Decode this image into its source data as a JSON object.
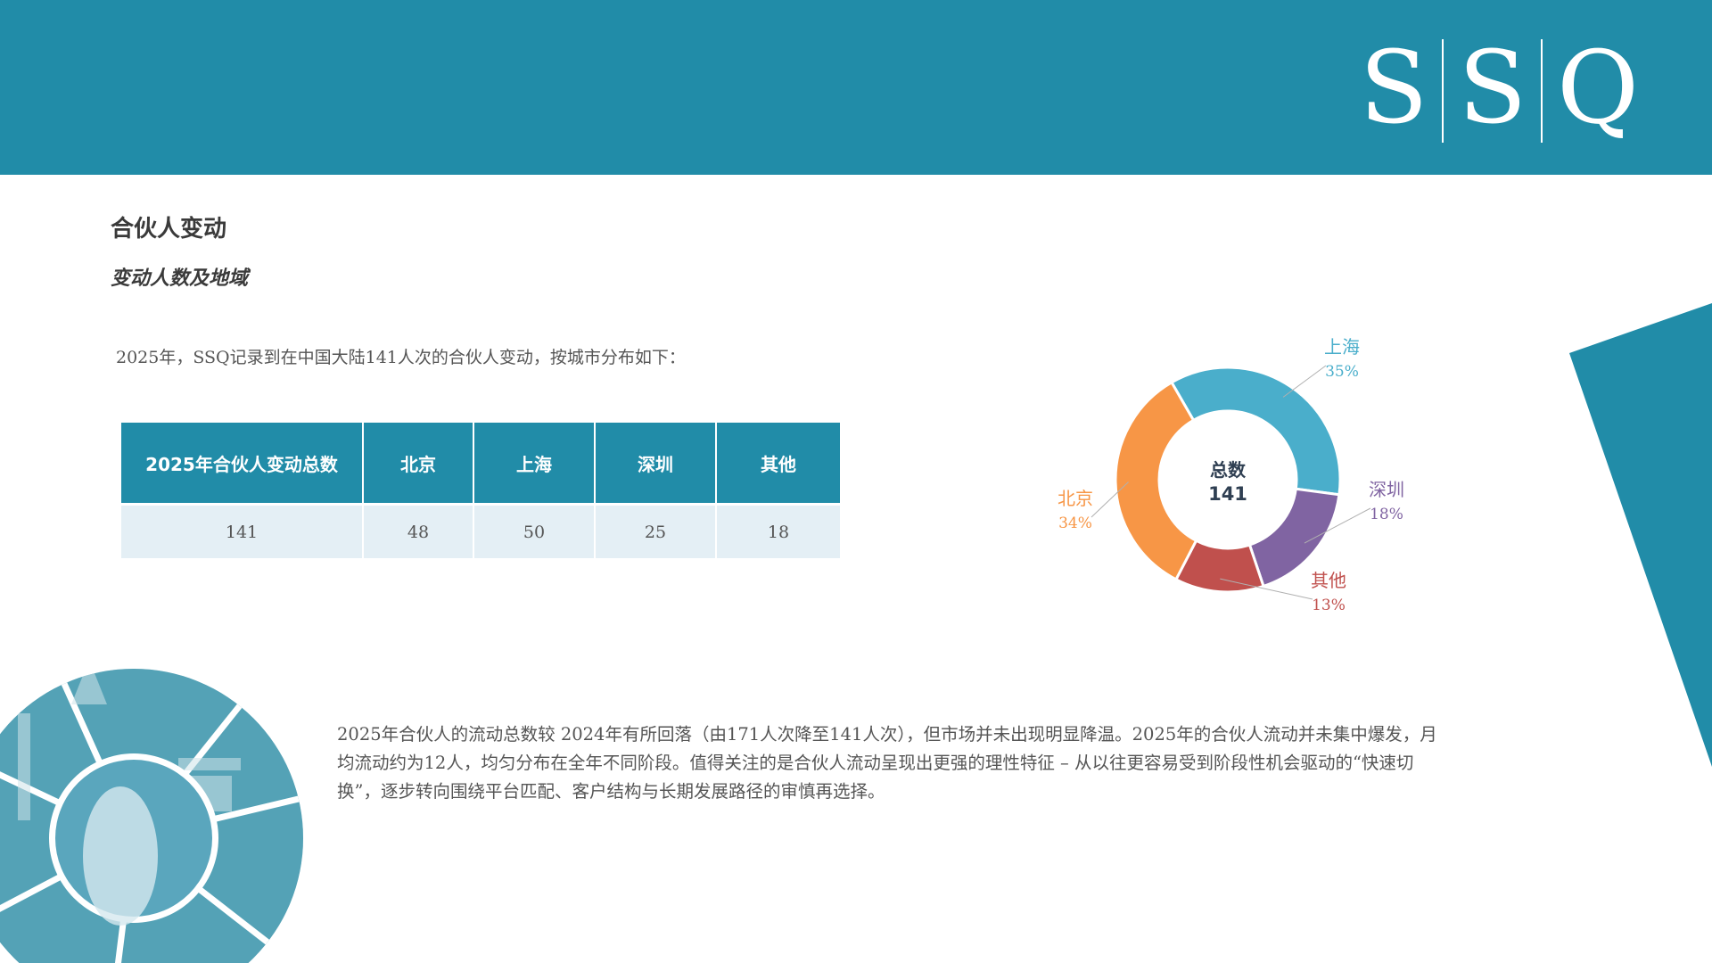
{
  "header": {
    "logo_letters": [
      "S",
      "S",
      "Q"
    ],
    "color": "#218ca8"
  },
  "section": {
    "title": "合伙人变动",
    "subtitle": "变动人数及地域"
  },
  "intro_text": "2025年，SSQ记录到在中国大陆141人次的合伙人变动，按城市分布如下：",
  "table": {
    "headers": [
      "2025年合伙人变动总数",
      "北京",
      "上海",
      "深圳",
      "其他"
    ],
    "values": [
      "141",
      "48",
      "50",
      "25",
      "18"
    ]
  },
  "chart_data": {
    "type": "pie",
    "variant": "donut",
    "center_label": "总数",
    "center_value": "141",
    "slices": [
      {
        "label": "上海",
        "percent": "35%",
        "value": 50,
        "color": "#4aaecb"
      },
      {
        "label": "深圳",
        "percent": "18%",
        "value": 25,
        "color": "#8064a2"
      },
      {
        "label": "其他",
        "percent": "13%",
        "value": 18,
        "color": "#c0504d"
      },
      {
        "label": "北京",
        "percent": "34%",
        "value": 48,
        "color": "#f79646"
      }
    ]
  },
  "body_text": "2025年合伙人的流动总数较 2024年有所回落（由171人次降至141人次），但市场并未出现明显降温。2025年的合伙人流动并未集中爆发，月均流动约为12人，均匀分布在全年不同阶段。值得关注的是合伙人流动呈现出更强的理性特征 – 从以往更容易受到阶段性机会驱动的“快速切换”，逐步转向围绕平台匹配、客户结构与长期发展路径的审慎再选择。",
  "colors": {
    "primary": "#218ca8",
    "table_row": "#e4eff5",
    "text": "#555555"
  }
}
